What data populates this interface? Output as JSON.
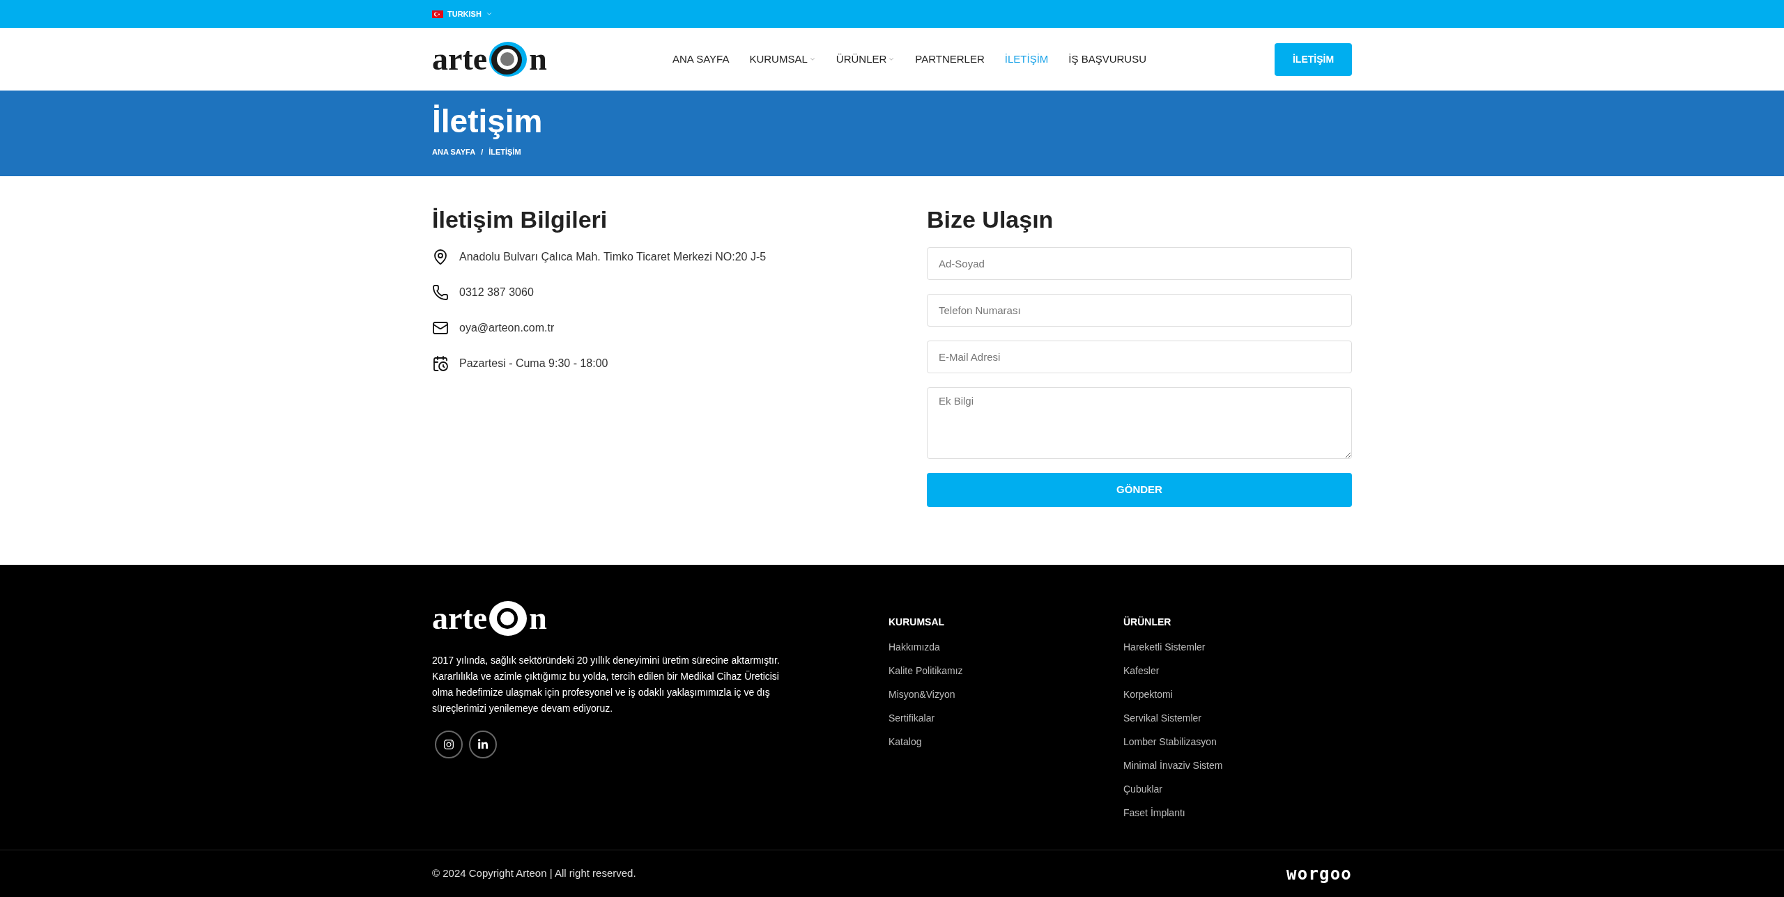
{
  "top_bar": {
    "language": "TURKISH"
  },
  "header": {
    "logo": {
      "before": "arte",
      "after": "n"
    },
    "nav": [
      {
        "label": "ANA SAYFA",
        "selected": false,
        "has_dropdown": false
      },
      {
        "label": "KURUMSAL",
        "selected": false,
        "has_dropdown": true
      },
      {
        "label": "ÜRÜNLER",
        "selected": false,
        "has_dropdown": true
      },
      {
        "label": "PARTNERLER",
        "selected": false,
        "has_dropdown": false
      },
      {
        "label": "İLETİŞİM",
        "selected": true,
        "has_dropdown": false
      },
      {
        "label": "İŞ BAŞVURUSU",
        "selected": false,
        "has_dropdown": false
      }
    ],
    "cta": "İLETİŞİM"
  },
  "banner": {
    "title": "İletişim",
    "breadcrumb": [
      "ANA SAYFA",
      "İLETİŞİM"
    ],
    "separator": "/"
  },
  "contact_info": {
    "title": "İletişim Bilgileri",
    "items": [
      {
        "kind": "address",
        "text": "Anadolu Bulvarı Çalıca Mah. Timko Ticaret Merkezi NO:20 J-5"
      },
      {
        "kind": "phone",
        "text": "0312 387 3060"
      },
      {
        "kind": "email",
        "text": "oya@arteon.com.tr"
      },
      {
        "kind": "hours",
        "text": "Pazartesi - Cuma 9:30 - 18:00"
      }
    ]
  },
  "form": {
    "title": "Bize Ulaşın",
    "fields": [
      {
        "kind": "input",
        "placeholder": "Ad-Soyad"
      },
      {
        "kind": "input",
        "placeholder": "Telefon Numarası"
      },
      {
        "kind": "input",
        "placeholder": "E-Mail Adresi"
      },
      {
        "kind": "textarea",
        "placeholder": "Ek Bilgi"
      }
    ],
    "submit": "GÖNDER"
  },
  "footer": {
    "logo": {
      "before": "arte",
      "after": "n"
    },
    "description": "2017 yılında, sağlık sektöründeki 20 yıllık deneyimini üretim sürecine aktarmıştır. Kararlılıkla ve azimle çıktığımız bu yolda, tercih edilen bir Medikal Cihaz Üreticisi olma hedefimize ulaşmak için profesyonel ve iş odaklı yaklaşımımızla iç ve dış süreçlerimizi yenilemeye devam ediyoruz.",
    "social": [
      {
        "kind": "instagram"
      },
      {
        "kind": "linkedin"
      }
    ],
    "columns": [
      {
        "title": "KURUMSAL",
        "links": [
          "Hakkımızda",
          "Kalite Politikamız",
          "Misyon&Vizyon",
          "Sertifikalar",
          "Katalog"
        ]
      },
      {
        "title": "ÜRÜNLER",
        "links": [
          "Hareketli Sistemler",
          "Kafesler",
          "Korpektomi",
          "Servikal Sistemler",
          "Lomber Stabilizasyon",
          "Minimal İnvaziv Sistem",
          "Çubuklar",
          "Faset İmplantı"
        ]
      }
    ],
    "copyright": "© 2024 Copyright Arteon | All right reserved.",
    "credit": "worgoo"
  }
}
